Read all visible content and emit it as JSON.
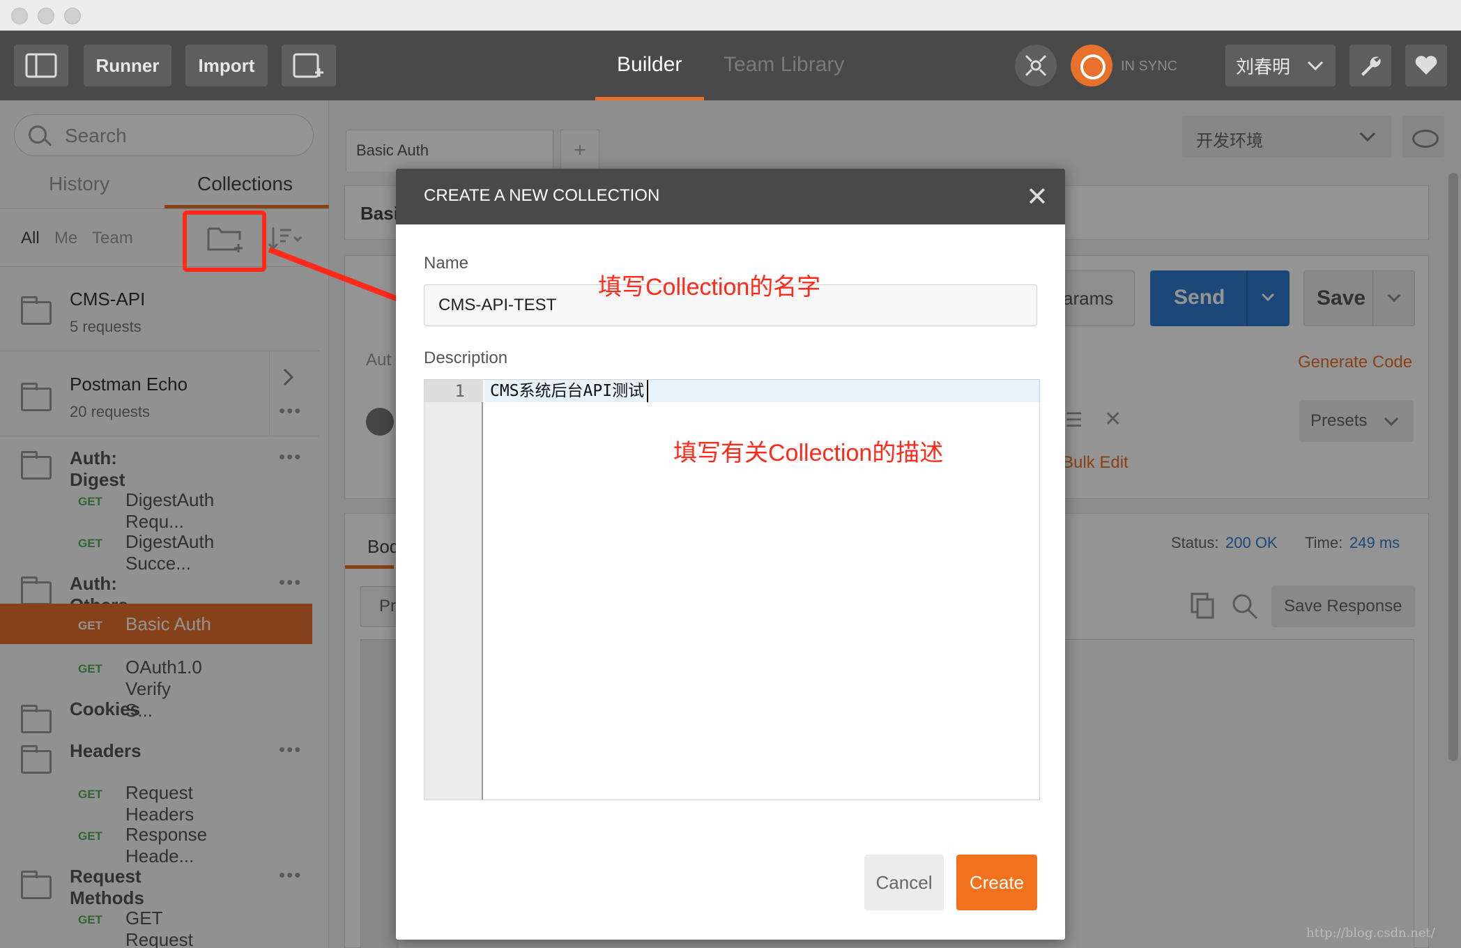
{
  "toolbar": {
    "runner_label": "Runner",
    "import_label": "Import",
    "builder_tab": "Builder",
    "team_library_tab": "Team Library",
    "sync_status": "IN SYNC",
    "user_name": "刘春明",
    "accent_color": "#e8712c"
  },
  "sidebar": {
    "search_placeholder": "Search",
    "tabs": {
      "history": "History",
      "collections": "Collections"
    },
    "filters": {
      "all": "All",
      "me": "Me",
      "team": "Team"
    },
    "collections": [
      {
        "name": "CMS-API",
        "count": "5 requests"
      },
      {
        "name": "Postman Echo",
        "count": "20 requests"
      }
    ],
    "tree": [
      {
        "kind": "folder",
        "name": "Auth: Digest"
      },
      {
        "kind": "request",
        "method": "GET",
        "name": "DigestAuth Requ..."
      },
      {
        "kind": "request",
        "method": "GET",
        "name": "DigestAuth Succe..."
      },
      {
        "kind": "folder",
        "name": "Auth: Others"
      },
      {
        "kind": "request",
        "method": "GET",
        "name": "Basic Auth",
        "active": true
      },
      {
        "kind": "request",
        "method": "GET",
        "name": "OAuth1.0 Verify S..."
      },
      {
        "kind": "folder",
        "name": "Cookies"
      },
      {
        "kind": "folder",
        "name": "Headers"
      },
      {
        "kind": "request",
        "method": "GET",
        "name": "Request Headers"
      },
      {
        "kind": "request",
        "method": "GET",
        "name": "Response Heade..."
      },
      {
        "kind": "folder",
        "name": "Request Methods"
      },
      {
        "kind": "request",
        "method": "GET",
        "name": "GET Request"
      }
    ]
  },
  "main": {
    "tab_title": "Basic Auth",
    "environment": "开发环境",
    "send_label": "Send",
    "save_label": "Save",
    "params_partial": "arams",
    "generate_code": "Generate Code",
    "presets": "Presets",
    "bulk_edit": "Bulk Edit",
    "basic_partial": "Basi",
    "auth_partial": "Aut",
    "body_partial": "Bod",
    "pretty_partial": "Pr",
    "status_label": "Status:",
    "status_value": "200 OK",
    "time_label": "Time:",
    "time_value": "249 ms",
    "save_response": "Save Response"
  },
  "modal": {
    "title": "CREATE A NEW COLLECTION",
    "name_label": "Name",
    "name_value": "CMS-API-TEST",
    "description_label": "Description",
    "description_line_no": "1",
    "description_text": "CMS系统后台API测试",
    "cancel_label": "Cancel",
    "create_label": "Create"
  },
  "annotations": {
    "name_note": "填写Collection的名字",
    "description_note": "填写有关Collection的描述",
    "color": "#ff2a1a"
  },
  "watermark": "http://blog.csdn.net/"
}
